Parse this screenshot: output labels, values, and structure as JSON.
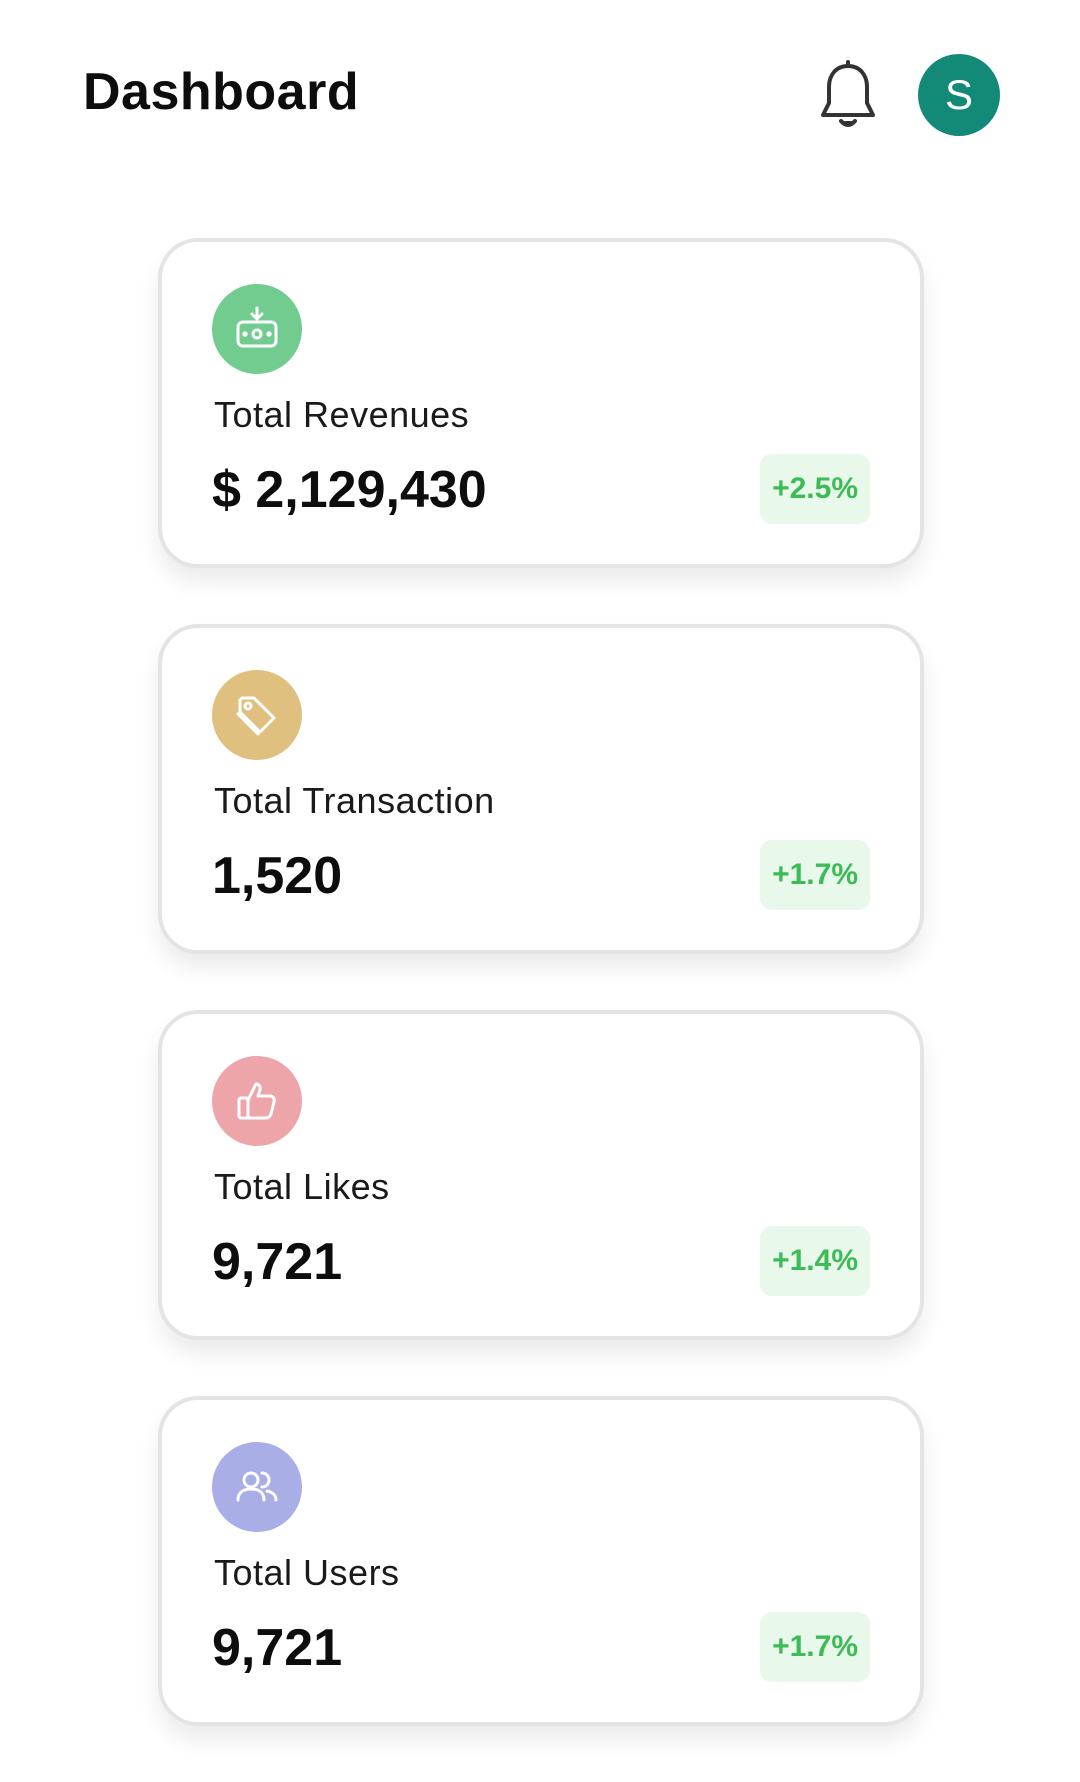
{
  "header": {
    "title": "Dashboard",
    "notification_icon": "bell-icon",
    "avatar_initial": "S",
    "avatar_color": "#138a78"
  },
  "cards": [
    {
      "label": "Total Revenues",
      "value": "$ 2,129,430",
      "change": "+2.5%",
      "icon": "money-icon",
      "icon_color": "#72cc8f"
    },
    {
      "label": "Total Transaction",
      "value": "1,520",
      "change": "+1.7%",
      "icon": "tag-icon",
      "icon_color": "#dfc07e"
    },
    {
      "label": "Total Likes",
      "value": "9,721",
      "change": "+1.4%",
      "icon": "thumbs-up-icon",
      "icon_color": "#eea5aa"
    },
    {
      "label": "Total Users",
      "value": "9,721",
      "change": "+1.7%",
      "icon": "users-icon",
      "icon_color": "#a9aee7"
    }
  ],
  "colors": {
    "positive_text": "#3dbb57",
    "positive_bg": "#e8f8ea"
  }
}
